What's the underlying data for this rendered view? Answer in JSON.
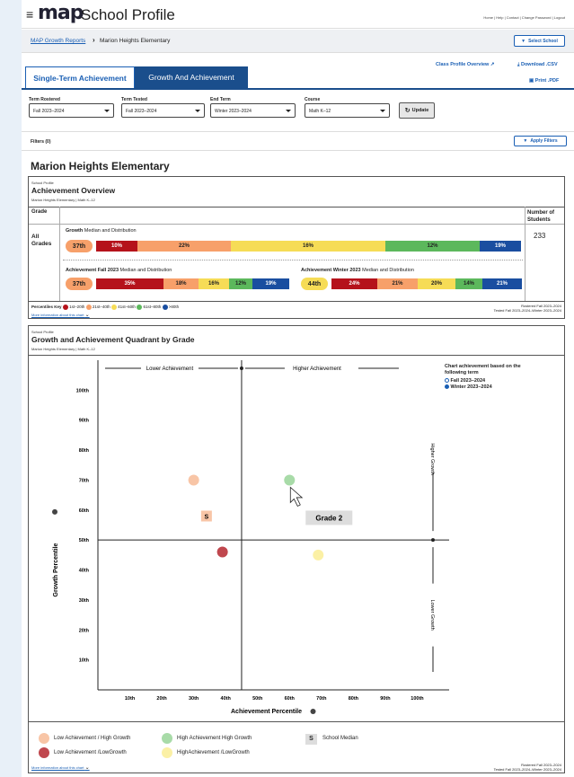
{
  "header": {
    "app_title": "School Profile",
    "logo_text": "map",
    "top_links": "Home | Help | Contact | Change Password | Logout"
  },
  "breadcrumb": {
    "root": "MAP Growth Reports",
    "current": "Marion Heights Elementary",
    "select_school": "Select School"
  },
  "tabs": [
    {
      "label": "Single-Term Achievement"
    },
    {
      "label": "Growth And Achievement"
    }
  ],
  "actions": {
    "class_profile": "Class Profile Overview",
    "download": "Download .CSV",
    "print": "Print .PDF"
  },
  "filters": {
    "term_rostered_label": "Term Rostered",
    "term_rostered": "Fall 2023–2024",
    "term_tested_label": "Term Tested",
    "term_tested": "Fall 2023–2024",
    "end_term_label": "End Term",
    "end_term": "Winter 2023–2024",
    "course_label": "Course",
    "course": "Math K–12",
    "update": "Update",
    "filters_count": "Filters (0)",
    "apply": "Apply Filters"
  },
  "school_name": "Marion Heights Elementary",
  "overview": {
    "eyebrow": "School Profile",
    "title": "Achievement Overview",
    "subtitle": "Marion Heights Elementary | Math K–12",
    "col_grade": "Grade",
    "col_students": "Number of Students",
    "row_grade": "All Grades",
    "students": "233",
    "growth_label": "Growth",
    "growth_suffix": "Median and Distribution",
    "growth_median": "37th",
    "growth_dist": [
      "10%",
      "22%",
      "16%",
      "12%",
      "19%"
    ],
    "fall_label": "Achievement Fall 2023",
    "fall_suffix": "Median and Distribution",
    "fall_median": "37th",
    "fall_dist": [
      "35%",
      "18%",
      "16%",
      "12%",
      "19%"
    ],
    "winter_label": "Achievement Winter 2023",
    "winter_suffix": "Median and Distribution",
    "winter_median": "44th",
    "winter_dist": [
      "24%",
      "21%",
      "20%",
      "14%",
      "21%"
    ],
    "key_label": "Percentiles Key",
    "key": [
      "1st–20th",
      "21st–40th",
      "41st–60th",
      "61st–80th",
      ">80th"
    ],
    "more_info": "More information about this chart",
    "rostered_note": "Rostered Fall 2023–2024",
    "tested_note": "Tested Fall 2023–2024–Winter 2023–2024"
  },
  "quadrant": {
    "eyebrow": "School Profile",
    "title": "Growth and Achievement Quadrant by Grade",
    "subtitle": "Marion Heights Elementary | Math K–12",
    "choose_title": "Chart achievement based on the following term",
    "term_options": [
      "Fall 2023–2024",
      "Winter 2023–2024"
    ],
    "selected_term": "Winter 2023–2024",
    "tooltip": "Grade 2",
    "legend": {
      "low_high": "Low Achievement / High Growth",
      "high_high": "High Achievement High Growth",
      "median": "School Median",
      "low_low": "Low Achievement /LowGrowth",
      "high_low": "HighAchievement /LowGrowth"
    },
    "more_info": "More information about this chart",
    "rostered_note": "Rostered Fall 2023–2024",
    "tested_note": "Tested Fall 2023–2024–Winter 2023–2024"
  },
  "colors": {
    "red": "#b5121b",
    "orange": "#f7a06a",
    "yellow": "#f6dc56",
    "green": "#5cb85c",
    "blue": "#1a4ea0",
    "brand": "#1a4e8c"
  },
  "chart_data": {
    "type": "scatter",
    "title": "Growth and Achievement Quadrant by Grade",
    "xlabel": "Achievement Percentile",
    "ylabel": "Growth Percentile",
    "xlim": [
      0,
      110
    ],
    "ylim": [
      0,
      110
    ],
    "x_ticks": [
      "10th",
      "20th",
      "30th",
      "40th",
      "50th",
      "60th",
      "70th",
      "80th",
      "90th",
      "100th"
    ],
    "y_ticks": [
      "10th",
      "20th",
      "30th",
      "40th",
      "50th",
      "60th",
      "70th",
      "80th",
      "90th",
      "100th"
    ],
    "quadrant_labels": {
      "top_left": "Lower Achievement",
      "top_right": "Higher  Achievement",
      "right_top": "Higher Growth",
      "right_bottom": "Lower Growth"
    },
    "median_marker": "S",
    "median": {
      "x": 45,
      "y": 50
    },
    "points": [
      {
        "x": 30,
        "y": 70,
        "quadrant": "low_high"
      },
      {
        "x": 60,
        "y": 70,
        "quadrant": "high_high",
        "label": "Grade 2"
      },
      {
        "x": 39,
        "y": 46,
        "quadrant": "low_low"
      },
      {
        "x": 69,
        "y": 45,
        "quadrant": "high_low"
      },
      {
        "x": 34,
        "y": 58,
        "quadrant": "median_marker"
      }
    ]
  }
}
